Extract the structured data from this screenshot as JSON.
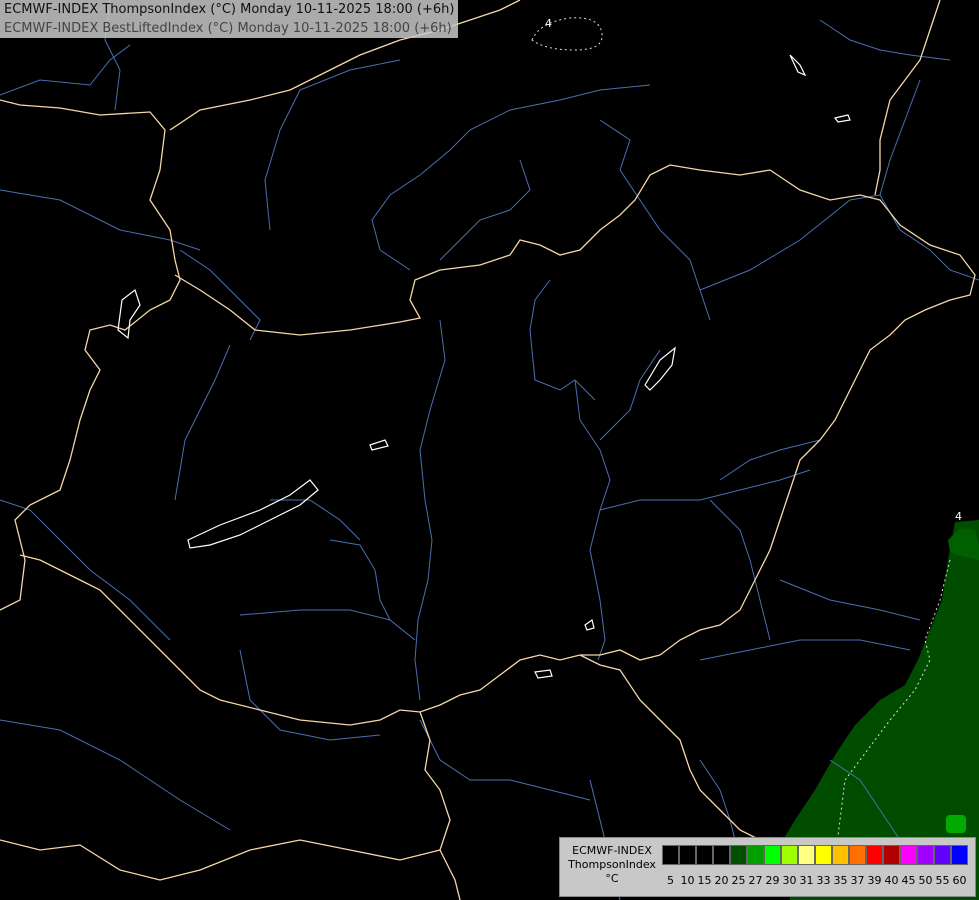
{
  "header": {
    "line1": "ECMWF-INDEX ThompsonIndex (°C) Monday 10-11-2025 18:00 (+6h)",
    "line2": "ECMWF-INDEX BestLiftedIndex (°C) Monday 10-11-2025 18:00 (+6h)"
  },
  "legend": {
    "line1": "ECMWF-INDEX",
    "line2": "ThompsonIndex",
    "line3": "°C",
    "bins": [
      {
        "color": "#000000",
        "label": "5"
      },
      {
        "color": "#000000",
        "label": "10"
      },
      {
        "color": "#000000",
        "label": "15"
      },
      {
        "color": "#000000",
        "label": "20"
      },
      {
        "color": "#005000",
        "label": "25"
      },
      {
        "color": "#00a000",
        "label": "27"
      },
      {
        "color": "#00ff00",
        "label": "29"
      },
      {
        "color": "#a0ff00",
        "label": "30"
      },
      {
        "color": "#ffff80",
        "label": "31"
      },
      {
        "color": "#ffff00",
        "label": "33"
      },
      {
        "color": "#ffc000",
        "label": "35"
      },
      {
        "color": "#ff7000",
        "label": "37"
      },
      {
        "color": "#ff0000",
        "label": "39"
      },
      {
        "color": "#b00000",
        "label": "40"
      },
      {
        "color": "#ff00ff",
        "label": "45"
      },
      {
        "color": "#a000ff",
        "label": "50"
      },
      {
        "color": "#6000ff",
        "label": "55"
      },
      {
        "color": "#0000ff",
        "label": "60"
      }
    ]
  },
  "map": {
    "colors": {
      "background": "#000000",
      "border": "#f5d6a8",
      "river": "#4a6fb0",
      "lake": "#ffffff",
      "field_dark": "#004d00",
      "field_light": "#00aa00"
    },
    "labels": [
      "4",
      "4"
    ]
  }
}
